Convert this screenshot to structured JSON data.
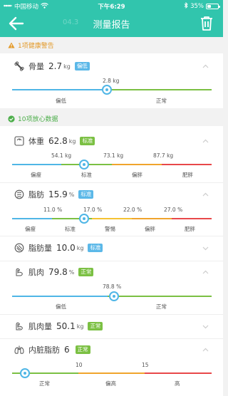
{
  "status_bar": {
    "carrier": "中国移动",
    "time": "下午6:29",
    "battery": "35%",
    "battery_level": 0.35
  },
  "nav": {
    "title": "测量报告",
    "ghost_text": "04.3"
  },
  "warning_section": {
    "title": "1项健康警告"
  },
  "ok_section": {
    "title": "10项放心数据"
  },
  "metrics": {
    "bone": {
      "name": "骨量",
      "value": "2.7",
      "unit": "kg",
      "status": "偏低",
      "status_color": "#5bb8e8",
      "marker_label": "2.8 kg",
      "scale_labels": [
        "偏低",
        "正常"
      ]
    },
    "weight": {
      "name": "体重",
      "value": "62.8",
      "unit": "kg",
      "status": "标准",
      "status_color": "#7bc043",
      "thresholds": [
        "54.1 kg",
        "73.1 kg",
        "87.7 kg"
      ],
      "scale_labels": [
        "偏瘦",
        "标准",
        "偏胖",
        "肥胖"
      ]
    },
    "fat": {
      "name": "脂肪",
      "value": "15.9",
      "unit": "%",
      "status": "标准",
      "status_color": "#5bb8e8",
      "thresholds": [
        "11.0 %",
        "17.0 %",
        "22.0 %",
        "27.0 %"
      ],
      "scale_labels": [
        "偏瘦",
        "标准",
        "警惕",
        "偏胖",
        "肥胖"
      ]
    },
    "fat_mass": {
      "name": "脂肪量",
      "value": "10.0",
      "unit": "kg",
      "status": "标准",
      "status_color": "#5bb8e8"
    },
    "muscle": {
      "name": "肌肉",
      "value": "79.8",
      "unit": "%",
      "status": "正常",
      "status_color": "#7bc043",
      "marker_label": "78.8 %",
      "scale_labels": [
        "偏低",
        "正常"
      ]
    },
    "muscle_mass": {
      "name": "肌肉量",
      "value": "50.1",
      "unit": "kg",
      "status": "正常",
      "status_color": "#7bc043"
    },
    "visceral": {
      "name": "内脏脂肪",
      "value": "6",
      "unit": "",
      "status": "正常",
      "status_color": "#7bc043",
      "thresholds": [
        "10",
        "15"
      ],
      "scale_labels": [
        "正常",
        "偏高",
        "高"
      ]
    }
  },
  "colors": {
    "header": "#31c5ad",
    "blue": "#4fb6e6",
    "green": "#7bc043",
    "orange": "#f0a42c",
    "red": "#e8484a"
  }
}
